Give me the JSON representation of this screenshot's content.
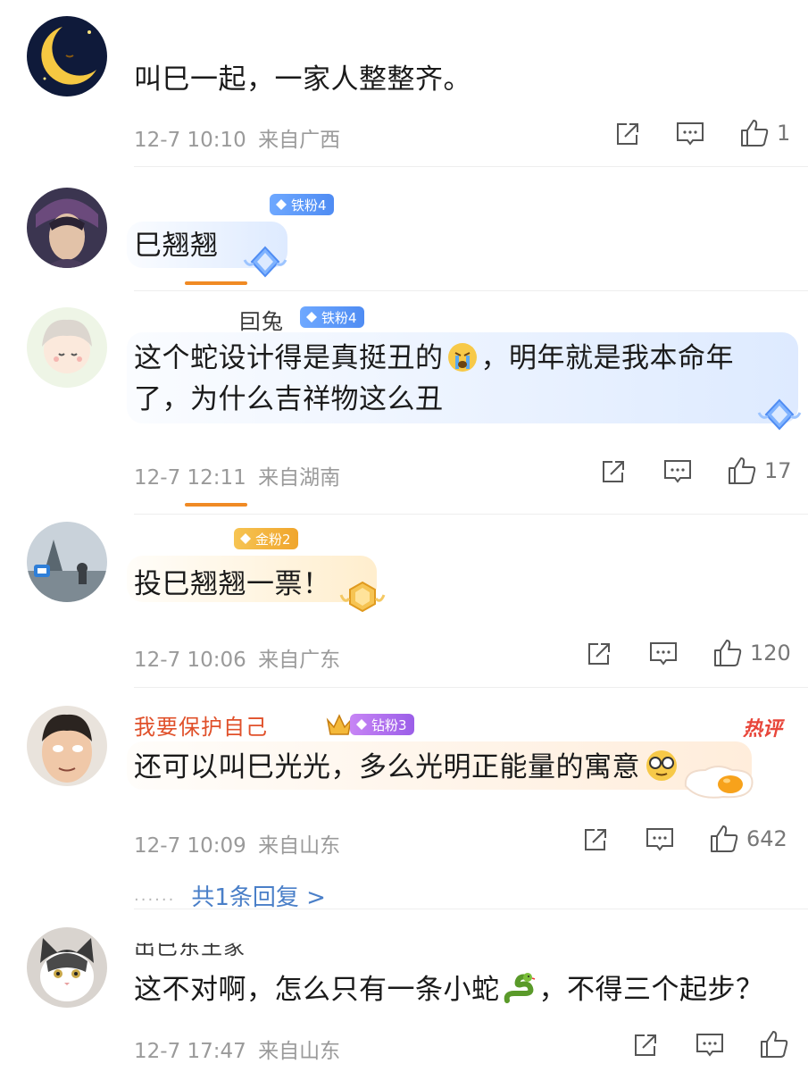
{
  "comments": [
    {
      "username": "",
      "text_lines": [
        "叫巳一起，一家人整整齐。"
      ],
      "time": "12-7 10:10",
      "location": "来自广西",
      "likes": "1"
    },
    {
      "username": "",
      "badge": "铁粉4",
      "text_lines": [
        "巳翘翘"
      ],
      "time": "",
      "location": "",
      "likes": ""
    },
    {
      "username": "囙兔",
      "badge": "铁粉4",
      "text_lines": [
        "这个蛇设计得是真挺丑的",
        "，明年就是我本命年",
        "了，为什么吉祥物这么丑"
      ],
      "time": "12-7 12:11",
      "location": "来自湖南",
      "likes": "17"
    },
    {
      "username": "",
      "badge": "金粉2",
      "text_lines": [
        "投巳翘翘一票！"
      ],
      "time": "12-7 10:06",
      "location": "来自广东",
      "likes": "120"
    },
    {
      "username": "我要保护自己",
      "badge": "钻粉3",
      "hot_label": "热评",
      "text_lines": [
        "还可以叫巳光光，多么光明正能量的寓意"
      ],
      "time": "12-7 10:09",
      "location": "来自山东",
      "likes": "642",
      "replies_label": "共1条回复 >"
    },
    {
      "username": "出巳东王家",
      "text_lines": [
        "这不对啊，怎么只有一条小蛇",
        "，不得三个起步？"
      ],
      "time": "12-7 17:47",
      "location": "来自山东",
      "likes": ""
    }
  ],
  "icons": {
    "share": "share-icon",
    "comment": "comment-icon",
    "like": "thumbs-up-icon",
    "crying_emoji": "crying-emoji-icon",
    "glasses_emoji": "glasses-emoji-icon",
    "snake_emoji": "snake-emoji-icon"
  },
  "colors": {
    "accent_orange": "#f08a24",
    "reply_link": "#4a7fc8",
    "hot_red": "#e8463a",
    "meta_gray": "#9a9a9a"
  }
}
